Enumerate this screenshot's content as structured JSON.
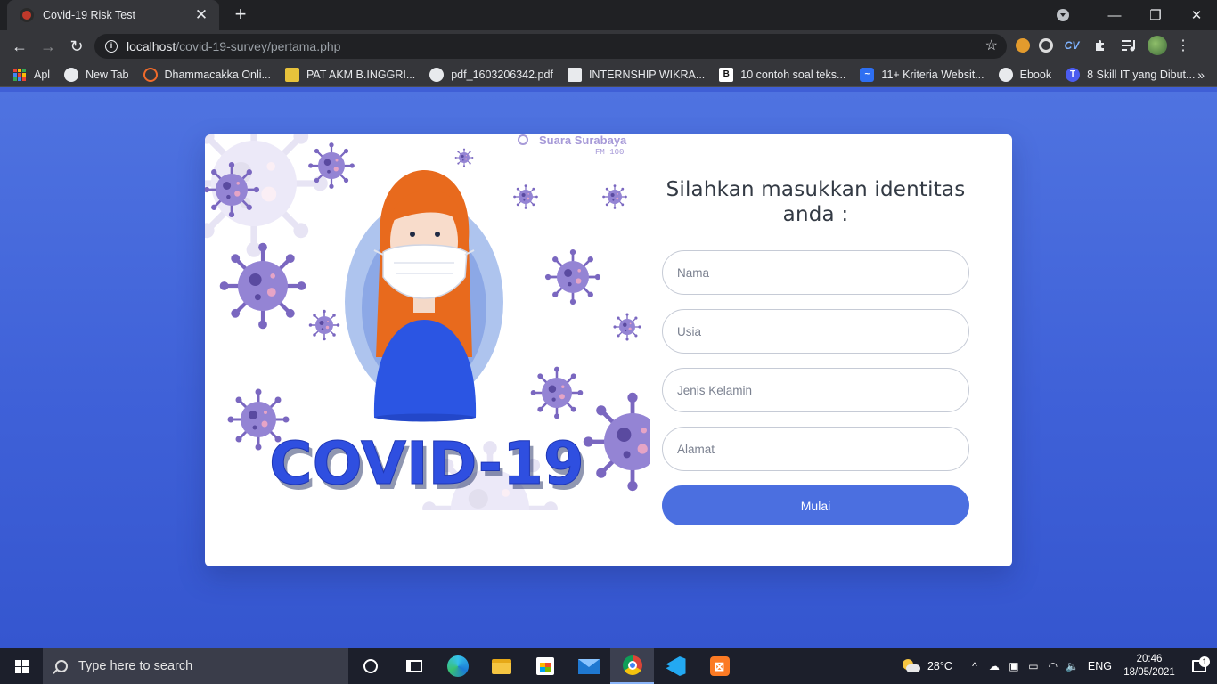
{
  "browser": {
    "tab_title": "Covid-19 Risk Test",
    "tab_close": "✕",
    "new_tab": "+",
    "window_controls": {
      "minimize": "—",
      "maximize": "❐",
      "close": "✕"
    },
    "nav": {
      "back": "←",
      "forward": "→",
      "reload": "↻"
    },
    "url_host": "localhost",
    "url_path": "/covid-19-survey/pertama.php",
    "star": "☆",
    "extensions": [
      "ext-icon-1",
      "ext-icon-2",
      "cv-extension-icon",
      "puzzle-icon",
      "media-icon",
      "profile-avatar"
    ],
    "ext_cv_label": "CV",
    "bookmarks": [
      {
        "label": "Apl",
        "icon": "apps-icon"
      },
      {
        "label": "New Tab",
        "icon": "globe-icon"
      },
      {
        "label": "Dhammacakka Onli...",
        "icon": "dharma-wheel-icon"
      },
      {
        "label": "PAT AKM B.INGGRI...",
        "icon": "image-icon"
      },
      {
        "label": "pdf_1603206342.pdf",
        "icon": "globe-icon"
      },
      {
        "label": "INTERNSHIP WIKRA...",
        "icon": "board-icon"
      },
      {
        "label": "10 contoh soal teks...",
        "icon": "b-icon"
      },
      {
        "label": "11+ Kriteria Websit...",
        "icon": "chart-icon"
      },
      {
        "label": "Ebook",
        "icon": "globe-icon"
      },
      {
        "label": "8 Skill IT yang Dibut...",
        "icon": "t-icon"
      }
    ],
    "bookmarks_more": "»"
  },
  "page": {
    "illustration": {
      "brand_line1": "Suara Surabaya",
      "brand_line2": "FM 100",
      "headline": "COVID-19"
    },
    "form": {
      "title": "Silahkan masukkan identitas anda :",
      "name_placeholder": "Nama",
      "age_placeholder": "Usia",
      "gender_placeholder": "Jenis Kelamin",
      "address_placeholder": "Alamat",
      "submit_label": "Mulai"
    }
  },
  "taskbar": {
    "search_placeholder": "Type here to search",
    "weather_temp": "28°C",
    "language": "ENG",
    "time": "20:46",
    "date": "18/05/2021",
    "notification_count": "1"
  },
  "colors": {
    "page_background": "#3f5fd6",
    "button": "#4b6fe0",
    "browser_dark": "#202124",
    "virus_purple": "#8a78c9"
  }
}
